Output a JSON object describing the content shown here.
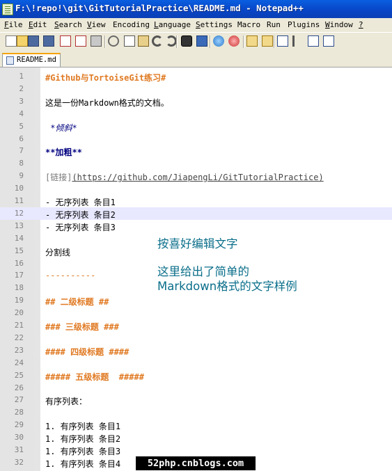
{
  "window": {
    "title": "F:\\!repo!\\git\\GitTutorialPractice\\README.md - Notepad++",
    "app_icon": "notepad-plus-plus-icon"
  },
  "menu": [
    {
      "label": "File",
      "mnemonic": "F",
      "rest": "ile"
    },
    {
      "label": "Edit",
      "mnemonic": "E",
      "rest": "dit"
    },
    {
      "label": "Search",
      "mnemonic": "S",
      "rest": "earch"
    },
    {
      "label": "View",
      "mnemonic": "V",
      "rest": "iew"
    },
    {
      "label": "Encoding",
      "mnemonic": "",
      "rest": "Encoding"
    },
    {
      "label": "Language",
      "mnemonic": "L",
      "rest": "anguage"
    },
    {
      "label": "Settings",
      "mnemonic": "S",
      "rest": "ettings"
    },
    {
      "label": "Macro",
      "mnemonic": "",
      "rest": "Macro"
    },
    {
      "label": "Run",
      "mnemonic": "",
      "rest": "Run"
    },
    {
      "label": "Plugins",
      "mnemonic": "",
      "rest": "Plugins"
    },
    {
      "label": "Window",
      "mnemonic": "W",
      "rest": "indow"
    },
    {
      "label": "?",
      "mnemonic": "?",
      "rest": ""
    }
  ],
  "toolbar": [
    "new-file-icon",
    "open-file-icon",
    "save-icon",
    "save-all-icon",
    "close-icon",
    "close-all-icon",
    "print-icon",
    "cut-icon",
    "copy-icon",
    "paste-icon",
    "undo-icon",
    "redo-icon",
    "find-icon",
    "replace-icon",
    "zoom-in-icon",
    "zoom-out-icon",
    "sync-vertical-icon",
    "sync-horizontal-icon",
    "word-wrap-icon",
    "show-all-chars-icon",
    "indent-guide-icon",
    "document-map-icon"
  ],
  "tab": {
    "label": "README.md",
    "icon": "document-icon"
  },
  "editor": {
    "current_line": 12,
    "lines": [
      {
        "n": "1",
        "parts": [
          {
            "t": "#Github与TortoiseGit练习#",
            "c": "hdr"
          }
        ]
      },
      {
        "n": "2",
        "parts": []
      },
      {
        "n": "3",
        "parts": [
          {
            "t": "这是一份Markdown格式的文档。",
            "c": ""
          }
        ]
      },
      {
        "n": "4",
        "parts": []
      },
      {
        "n": "5",
        "parts": [
          {
            "t": " *倾斜*",
            "c": "ital"
          }
        ]
      },
      {
        "n": "6",
        "parts": []
      },
      {
        "n": "7",
        "parts": [
          {
            "t": "**加粗**",
            "c": "bold"
          }
        ]
      },
      {
        "n": "8",
        "parts": []
      },
      {
        "n": "9",
        "parts": [
          {
            "t": "[链接]",
            "c": "link"
          },
          {
            "t": "(https://github.com/JiapengLi/GitTutorialPractice)",
            "c": "url"
          }
        ]
      },
      {
        "n": "10",
        "parts": []
      },
      {
        "n": "11",
        "parts": [
          {
            "t": "- 无序列表 条目1",
            "c": ""
          }
        ]
      },
      {
        "n": "12",
        "parts": [
          {
            "t": "- 无序列表 条目2",
            "c": ""
          }
        ]
      },
      {
        "n": "13",
        "parts": [
          {
            "t": "- 无序列表 条目3",
            "c": ""
          }
        ]
      },
      {
        "n": "14",
        "parts": []
      },
      {
        "n": "15",
        "parts": [
          {
            "t": "分割线",
            "c": ""
          }
        ]
      },
      {
        "n": "16",
        "parts": []
      },
      {
        "n": "17",
        "parts": [
          {
            "t": "----------",
            "c": "hr"
          }
        ]
      },
      {
        "n": "18",
        "parts": []
      },
      {
        "n": "19",
        "parts": [
          {
            "t": "## 二级标题 ##",
            "c": "hdr"
          }
        ]
      },
      {
        "n": "20",
        "parts": []
      },
      {
        "n": "21",
        "parts": [
          {
            "t": "### 三级标题 ###",
            "c": "hdr"
          }
        ]
      },
      {
        "n": "22",
        "parts": []
      },
      {
        "n": "23",
        "parts": [
          {
            "t": "#### 四级标题 ####",
            "c": "hdr"
          }
        ]
      },
      {
        "n": "24",
        "parts": []
      },
      {
        "n": "25",
        "parts": [
          {
            "t": "##### 五级标题  #####",
            "c": "hdr"
          }
        ]
      },
      {
        "n": "26",
        "parts": []
      },
      {
        "n": "27",
        "parts": [
          {
            "t": "有序列表：",
            "c": ""
          }
        ]
      },
      {
        "n": "28",
        "parts": []
      },
      {
        "n": "29",
        "parts": [
          {
            "t": "1. 有序列表 条目1",
            "c": ""
          }
        ]
      },
      {
        "n": "30",
        "parts": [
          {
            "t": "1. 有序列表 条目2",
            "c": ""
          }
        ]
      },
      {
        "n": "31",
        "parts": [
          {
            "t": "1. 有序列表 条目3",
            "c": ""
          }
        ]
      },
      {
        "n": "32",
        "parts": [
          {
            "t": "1. 有序列表 条目4",
            "c": ""
          }
        ]
      }
    ]
  },
  "annotations": {
    "edit_hint": "按喜好编辑文字",
    "sample_line1": "这里给出了简单的",
    "sample_line2": "Markdown格式的文字样例"
  },
  "watermark": "52php.cnblogs.com",
  "colors": {
    "heading": "#e07a23",
    "bold": "#000080",
    "annotation": "#0a6e8a",
    "current_line": "#e8e8ff"
  }
}
